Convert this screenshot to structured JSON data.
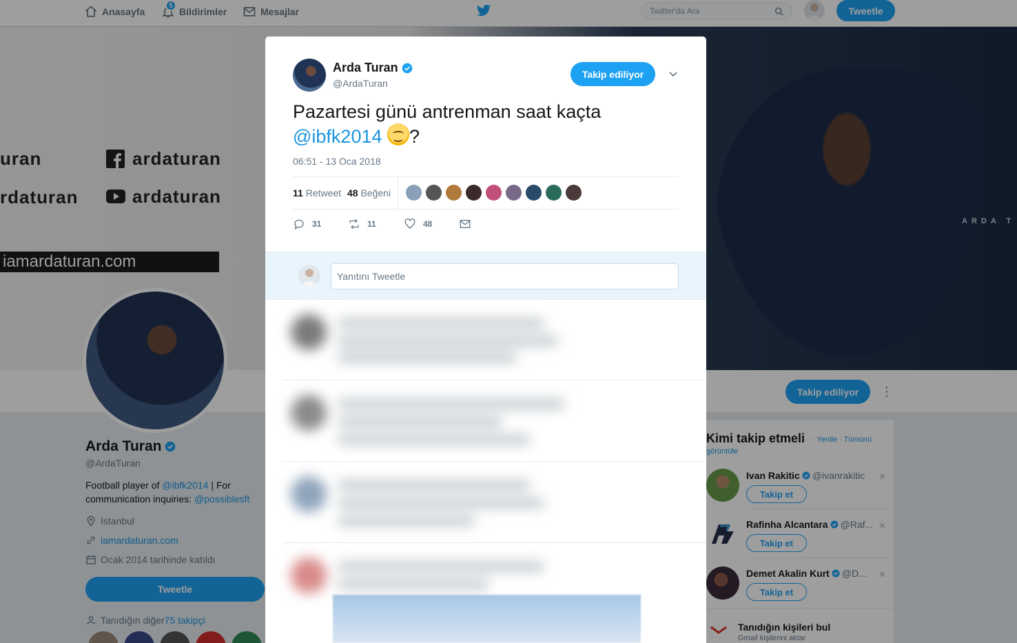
{
  "nav": {
    "home_label": "Anasayfa",
    "notifications_label": "Bildirimler",
    "notifications_count": "5",
    "messages_label": "Mesajlar",
    "search_placeholder": "Twitter'da Ara",
    "tweet_button": "Tweetle"
  },
  "banner": {
    "facebook": "ardaturan",
    "youtube": "ardaturan",
    "left_text_1": "uran",
    "left_text_2": "rdaturan",
    "url": "iamardaturan.com",
    "runner_text": "ARDA T"
  },
  "profile": {
    "name": "Arda Turan",
    "handle": "@ArdaTuran",
    "bio_prefix": "Football player of ",
    "bio_link_1": "@ibfk2014",
    "bio_middle": " | For communication inquiries: ",
    "bio_link_2": "@possiblesft",
    "location": "Istanbul",
    "website": "iamardaturan.com",
    "joined": "Ocak 2014 tarihinde katıldı",
    "tweet_button": "Tweetle",
    "followers_prefix": "Tanıdığın diğer ",
    "followers_link": "75 takipçi",
    "follow_state": "Takip ediliyor"
  },
  "who_to_follow": {
    "title": "Kimi takip etmeli",
    "refresh": "· Yenile · Tümünü",
    "view": "görüntüle",
    "items": [
      {
        "name": "Ivan Rakitic",
        "handle": "@ivanrakitic",
        "button": "Takip et"
      },
      {
        "name": "Rafinha Alcantara",
        "handle": "@Raf...",
        "button": "Takip et"
      },
      {
        "name": "Demet Akalin Kurt",
        "handle": "@D...",
        "button": "Takip et"
      }
    ],
    "find_title": "Tanıdığın kişileri bul",
    "find_sub": "Gmail kişilerini aktar"
  },
  "tweet": {
    "author_name": "Arda Turan",
    "author_handle": "@ArdaTuran",
    "follow_state": "Takip ediliyor",
    "text_line1": "Pazartesi günü antrenman saat kaçta",
    "mention": "@ibfk2014",
    "text_end": "?",
    "timestamp": "06:51 - 13 Oca 2018",
    "retweet_count": "11",
    "retweet_label": "Retweet",
    "like_count": "48",
    "like_label": "Beğeni",
    "reply_action_count": "31",
    "retweet_action_count": "11",
    "like_action_count": "48",
    "reply_placeholder": "Yanıtını Tweetle"
  },
  "colors": {
    "accent": "#1da1f2",
    "link": "#1b95e0",
    "verified": "#1da1f2"
  }
}
